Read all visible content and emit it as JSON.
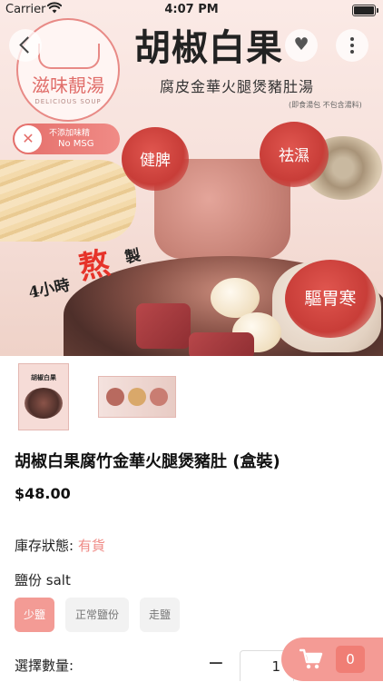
{
  "status_bar": {
    "carrier": "Carrier",
    "time": "4:07 PM"
  },
  "nav": {
    "back_icon": "chevron-left-icon",
    "favorite_icon": "heart-icon",
    "more_icon": "more-vertical-icon"
  },
  "hero": {
    "logo_text": "滋味靚湯",
    "logo_sub": "DELICIOUS SOUP",
    "title": "胡椒白果",
    "subtitle": "腐皮金華火腿煲豬肚湯",
    "note": "(即食湯包 不包含湯料)",
    "msg_badge_line1": "不添加味精",
    "msg_badge_line2": "No MSG",
    "bubble_1": "健脾",
    "bubble_2": "祛濕",
    "bubble_3": "驅胃寒",
    "heat_pre": "4小時",
    "heat_fire": "熬",
    "heat_post": "製"
  },
  "product": {
    "name": "胡椒白果腐竹金華火腿煲豬肚 (盒裝)",
    "price": "$48.00",
    "stock_label": "庫存狀態:",
    "stock_value": "有貨",
    "option_label": "鹽份 salt",
    "options": [
      "少鹽",
      "正常鹽份",
      "走鹽"
    ],
    "selected_option": "少鹽",
    "thumb1_title": "胡椒白果",
    "quantity_label": "選擇數量:",
    "quantity_minus": "−",
    "quantity_value": "1"
  },
  "cart": {
    "icon": "shopping-cart-icon",
    "count": "0"
  },
  "colors": {
    "accent": "#f39b95",
    "stock_available": "#ef8a85",
    "cart_badge": "#f07e75"
  }
}
